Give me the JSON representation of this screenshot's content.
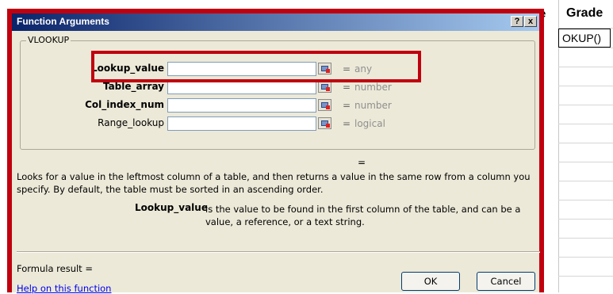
{
  "sheet": {
    "col_header_partial": "e",
    "col_header_grade": "Grade",
    "active_cell_text": "OKUP()"
  },
  "dialog": {
    "title": "Function Arguments",
    "help_btn": "?",
    "close_btn": "x",
    "function_name": "VLOOKUP",
    "args": [
      {
        "label": "Lookup_value",
        "value": "",
        "eq": "=",
        "type": "any",
        "bold": true
      },
      {
        "label": "Table_array",
        "value": "",
        "eq": "=",
        "type": "number",
        "bold": true
      },
      {
        "label": "Col_index_num",
        "value": "",
        "eq": "=",
        "type": "number",
        "bold": true
      },
      {
        "label": "Range_lookup",
        "value": "",
        "eq": "=",
        "type": "logical",
        "bold": false
      }
    ],
    "result_eq": "=",
    "description": "Looks for a value in the leftmost column of a table, and then returns a value in the same row from a column you specify. By default, the table must be sorted in an ascending order.",
    "arg_desc_name": "Lookup_value",
    "arg_desc_text": "is the value to be found in the first column of the table, and can be a value, a reference, or a text string.",
    "formula_result": "Formula result =",
    "help_link": "Help on this function",
    "ok_label": "OK",
    "cancel_label": "Cancel"
  },
  "colors": {
    "highlight": "#c0000f",
    "titlebar_start": "#0a246a",
    "dialog_bg": "#ece9d8",
    "link": "#0000ee"
  }
}
